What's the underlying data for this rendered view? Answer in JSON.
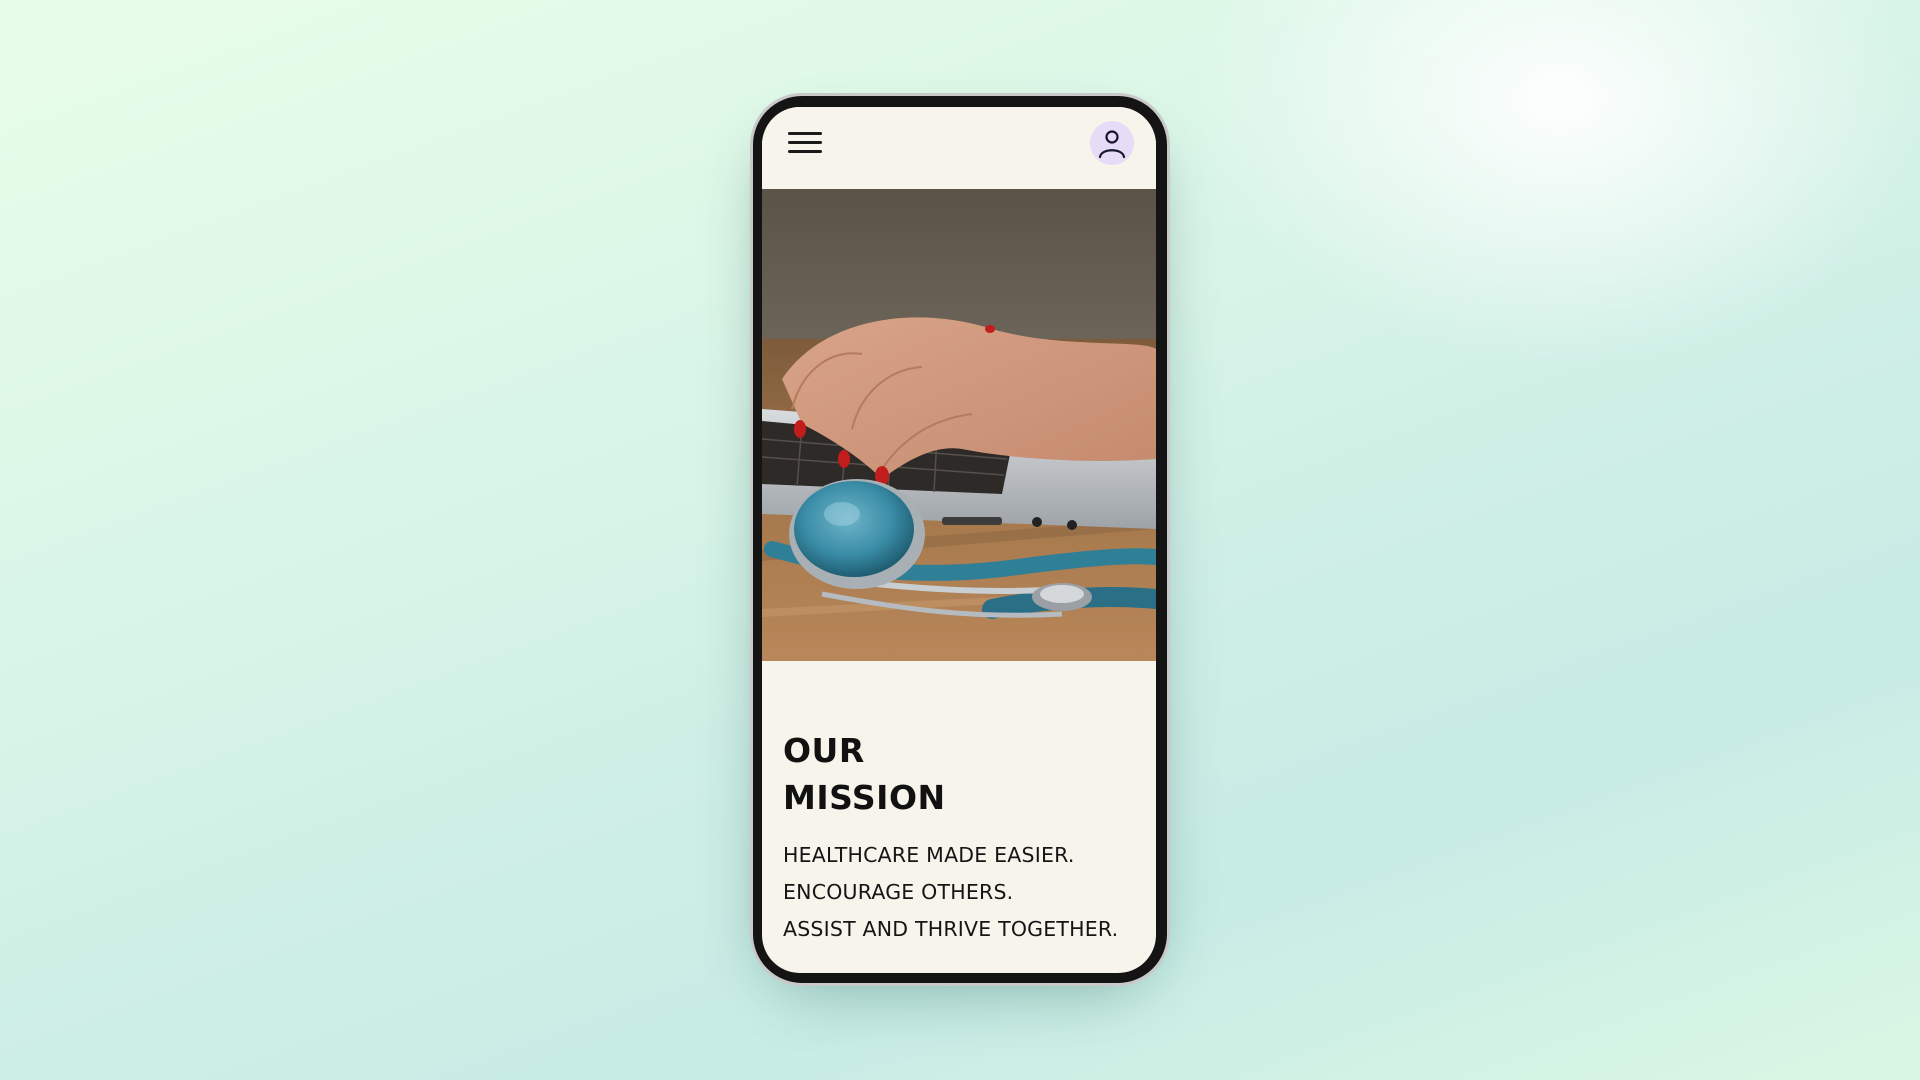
{
  "app": {
    "header": {
      "menu_icon": "hamburger-menu-icon",
      "avatar_icon": "user-avatar-icon",
      "avatar_bg": "#e6dcf8"
    },
    "hero": {
      "alt": "Hands typing on a laptop next to a stethoscope"
    },
    "mission": {
      "title_lines": [
        "OUR",
        "MISSION"
      ],
      "lines": [
        "HEALTHCARE MADE EASIER.",
        "ENCOURAGE OTHERS.",
        "ASSIST AND THRIVE TOGETHER."
      ]
    }
  },
  "colors": {
    "screen_bg": "#f7f4ec",
    "accent_avatar": "#e6dcf8",
    "stethoscope": "#2f7f97",
    "background_mint": "#c7ece6"
  }
}
